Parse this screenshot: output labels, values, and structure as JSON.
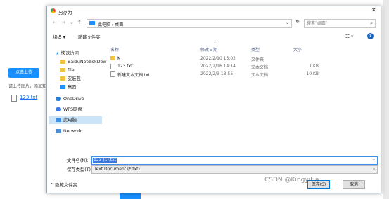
{
  "background": {
    "upload_button": "点击上传",
    "hint": "请上传图片，添加知",
    "file_link": "123.txt"
  },
  "dialog": {
    "title": "另存为",
    "close": "✕",
    "nav": {
      "back": "←",
      "forward": "→",
      "dropdown": "⌄",
      "up": "↑"
    },
    "breadcrumb": "此电脑  ›  桌面",
    "refresh": "↻",
    "search_placeholder": "搜索\"桌面\"",
    "toolbar": {
      "organize": "组织 ▾",
      "new_folder": "新建文件夹",
      "view": "☷ ▾",
      "help": "?"
    },
    "sidebar": [
      {
        "label": "快速访问",
        "icon": "star-icon"
      },
      {
        "label": "BaiduNetdiskDow",
        "icon": "folder-icon"
      },
      {
        "label": "file",
        "icon": "folder-icon"
      },
      {
        "label": "安装包",
        "icon": "folder-icon"
      },
      {
        "label": "桌面",
        "icon": "desktop-icon"
      },
      {
        "label": "OneDrive",
        "icon": "cloud-icon"
      },
      {
        "label": "WPS网盘",
        "icon": "cloud-icon"
      },
      {
        "label": "此电脑",
        "icon": "computer-icon"
      },
      {
        "label": "Network",
        "icon": "network-icon"
      }
    ],
    "columns": {
      "name": "名称",
      "date": "修改日期",
      "type": "类型",
      "size": "大小"
    },
    "files": [
      {
        "name": "K",
        "date": "2022/2/10 15:02",
        "type": "文件夹",
        "size": ""
      },
      {
        "name": "123.txt",
        "date": "2022/2/16 14:14",
        "type": "文本文档",
        "size": "1 KB"
      },
      {
        "name": "新建文本文档.txt",
        "date": "2022/2/3 13:55",
        "type": "文本文档",
        "size": "10 KB"
      }
    ],
    "filename_label": "文件名(N):",
    "filename_value": "123 (1).txt",
    "filetype_label": "保存类型(T):",
    "filetype_value": "Text Document (*.txt)",
    "hide_folders": "^  隐藏文件夹",
    "save_button": "保存(S)",
    "cancel_button": "取消"
  },
  "watermark": "CSDN @KingyiHa"
}
